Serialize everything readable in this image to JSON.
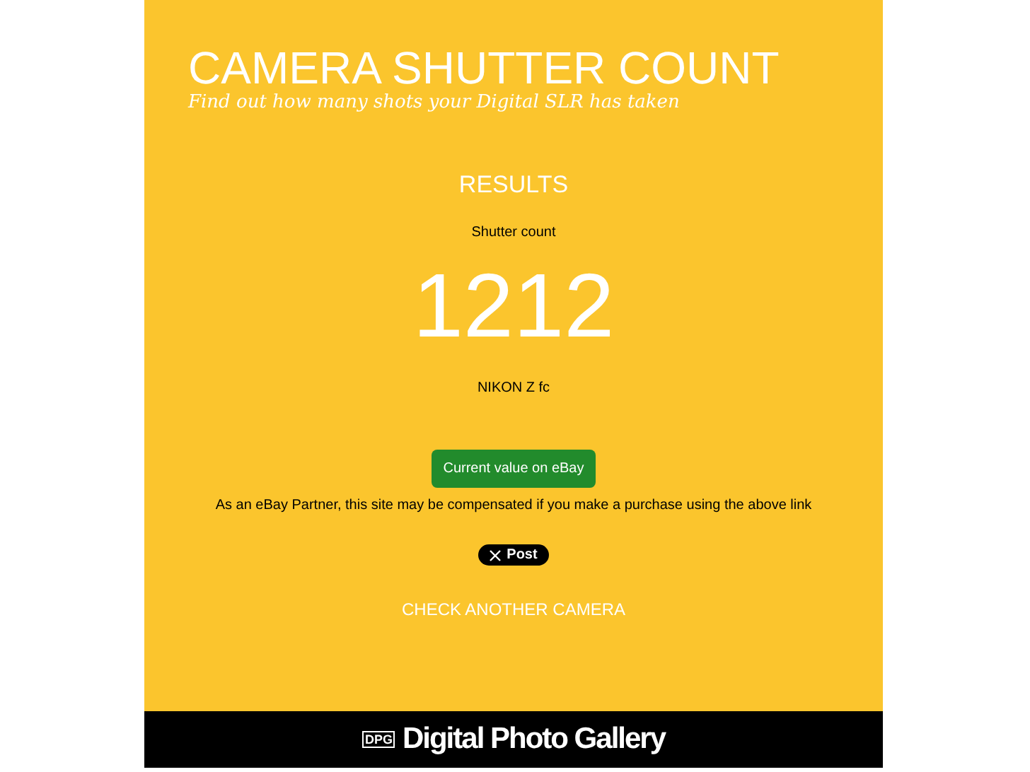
{
  "header": {
    "title": "CAMERA SHUTTER COUNT",
    "subtitle": "Find out how many shots your Digital SLR has taken"
  },
  "results": {
    "heading": "RESULTS",
    "label": "Shutter count",
    "count": "1212",
    "camera": "NIKON Z fc"
  },
  "ebay_button": "Current value on eBay",
  "disclaimer": "As an eBay Partner, this site may be compensated if you make a purchase using the above link",
  "post_button": "Post",
  "check_link": "CHECK ANOTHER CAMERA",
  "footer": {
    "logo_mark": "DPG",
    "brand": "Digital Photo Gallery"
  }
}
